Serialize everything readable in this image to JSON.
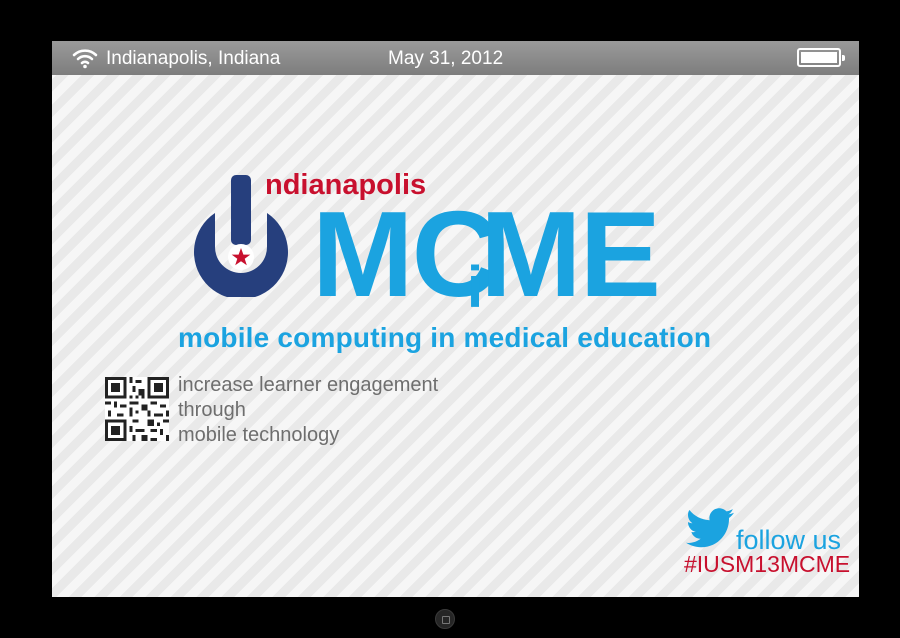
{
  "status_bar": {
    "wifi_icon": "wifi-icon",
    "location": "Indianapolis, Indiana",
    "date": "May 31, 2012",
    "battery_icon": "battery-icon",
    "battery_level": 1.0
  },
  "logo": {
    "city": "ndianapolis",
    "title_left": "MC",
    "title_mid": "i",
    "title_right": "ME",
    "tagline": "mobile computing in medical education",
    "colors": {
      "navy": "#263f7d",
      "blue": "#1ba3e0",
      "red": "#c8102e"
    }
  },
  "blurb": {
    "qr_icon": "qr-code",
    "lines": [
      "increase learner engagement",
      "through",
      "mobile technology"
    ]
  },
  "social": {
    "icon": "twitter-bird-icon",
    "follow_label": "follow us",
    "hashtag": "#IUSM13MCME"
  }
}
